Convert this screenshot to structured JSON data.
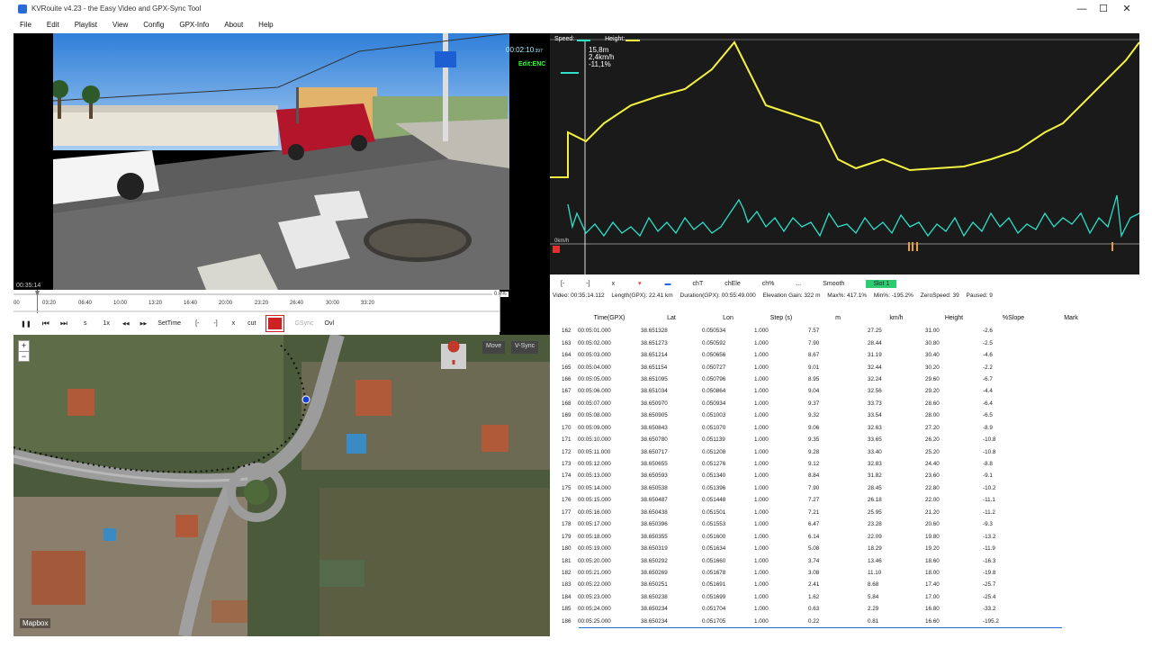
{
  "window": {
    "title": "KVRouite v4.23 - the Easy Video and GPX-Sync Tool",
    "minimize": "—",
    "maximize": "☐",
    "close": "✕"
  },
  "menu": [
    "File",
    "Edit",
    "Playlist",
    "View",
    "Config",
    "GPX-Info",
    "About",
    "Help"
  ],
  "video": {
    "timecode": "00:02:10",
    "timecode_suffix": ".397",
    "edit_state": "Edit:ENC",
    "position_time": "00:35:14",
    "percent": "0.0%"
  },
  "timeline": {
    "ticks": [
      "00",
      "03:20",
      "06:40",
      "10:00",
      "13:20",
      "16:40",
      "20:00",
      "23:20",
      "26:40",
      "30:00",
      "33:20"
    ]
  },
  "controls": {
    "pause": "❚❚",
    "prev": "⏮",
    "next": "⏭",
    "s": "s",
    "speed": "1x",
    "rew": "◀◀",
    "fwd": "▶▶",
    "settime": "SetTime",
    "mark_in": "[-",
    "mark_out": "-]",
    "x": "x",
    "cut": "cut",
    "gsync": "GSync",
    "ovl": "Ovl"
  },
  "map": {
    "zoom_in": "+",
    "zoom_out": "−",
    "move": "Move",
    "vsync": "V-Sync",
    "attribution": "Mapbox"
  },
  "chart": {
    "legend_speed": "Speed:",
    "legend_height": "Height:",
    "readout": [
      "15,8m",
      "2,4km/h",
      "-11,1%"
    ],
    "unit_label": "0km/h",
    "speed_color": "#2de0c8",
    "height_color": "#f4f240"
  },
  "chart_ctl": [
    "[-",
    "-]",
    "x",
    "🔻",
    "▬",
    "chT",
    "chEle",
    "ch%",
    "...",
    "Smooth"
  ],
  "slot": "Slot 1",
  "info": [
    "Video: 00:35:14.112",
    "Length(GPX): 22.41 km",
    "Duration(GPX): 00:55:49.000",
    "Elevation Gain: 322 m",
    "Max%: 417.1%",
    "Min%: -195.2%",
    "ZeroSpeed: 39",
    "Paused: 9"
  ],
  "table": {
    "headers": [
      "",
      "Time(GPX)",
      "Lat",
      "Lon",
      "Step (s)",
      "m",
      "km/h",
      "Height",
      "%Slope",
      "Mark"
    ],
    "rows": [
      [
        "162",
        "00:05:01.000",
        "38.651328",
        "0.050534",
        "1.000",
        "7.57",
        "27.25",
        "31.00",
        "-2.6"
      ],
      [
        "163",
        "00:05:02.000",
        "38.651273",
        "0.050592",
        "1.000",
        "7.90",
        "28.44",
        "30.80",
        "-2.5"
      ],
      [
        "164",
        "00:05:03.000",
        "38.651214",
        "0.050656",
        "1.000",
        "8.67",
        "31.19",
        "30.40",
        "-4.6"
      ],
      [
        "165",
        "00:05:04.000",
        "38.651154",
        "0.050727",
        "1.000",
        "9.01",
        "32.44",
        "30.20",
        "-2.2"
      ],
      [
        "166",
        "00:05:05.000",
        "38.651095",
        "0.050796",
        "1.000",
        "8.95",
        "32.24",
        "29.60",
        "-6.7"
      ],
      [
        "167",
        "00:05:06.000",
        "38.651034",
        "0.050864",
        "1.000",
        "9.04",
        "32.56",
        "29.20",
        "-4.4"
      ],
      [
        "168",
        "00:05:07.000",
        "38.650970",
        "0.050934",
        "1.000",
        "9.37",
        "33.73",
        "28.60",
        "-6.4"
      ],
      [
        "169",
        "00:05:08.000",
        "38.650905",
        "0.051003",
        "1.000",
        "9.32",
        "33.54",
        "28.00",
        "-6.5"
      ],
      [
        "170",
        "00:05:09.000",
        "38.650843",
        "0.051070",
        "1.000",
        "9.06",
        "32.63",
        "27.20",
        "-8.9"
      ],
      [
        "171",
        "00:05:10.000",
        "38.650780",
        "0.051139",
        "1.000",
        "9.35",
        "33.65",
        "26.20",
        "-10.8"
      ],
      [
        "172",
        "00:05:11.000",
        "38.650717",
        "0.051208",
        "1.000",
        "9.28",
        "33.40",
        "25.20",
        "-10.8"
      ],
      [
        "173",
        "00:05:12.000",
        "38.650655",
        "0.051276",
        "1.000",
        "9.12",
        "32.83",
        "24.40",
        "-8.8"
      ],
      [
        "174",
        "00:05:13.000",
        "38.650593",
        "0.051340",
        "1.000",
        "8.84",
        "31.82",
        "23.60",
        "-9.1"
      ],
      [
        "175",
        "00:05:14.000",
        "38.650538",
        "0.051396",
        "1.000",
        "7.90",
        "28.45",
        "22.80",
        "-10.2"
      ],
      [
        "176",
        "00:05:15.000",
        "38.650487",
        "0.051448",
        "1.000",
        "7.27",
        "26.18",
        "22.00",
        "-11.1"
      ],
      [
        "177",
        "00:05:16.000",
        "38.650438",
        "0.051501",
        "1.000",
        "7.21",
        "25.95",
        "21.20",
        "-11.2"
      ],
      [
        "178",
        "00:05:17.000",
        "38.650396",
        "0.051553",
        "1.000",
        "6.47",
        "23.28",
        "20.60",
        "-9.3"
      ],
      [
        "179",
        "00:05:18.000",
        "38.650355",
        "0.051600",
        "1.000",
        "6.14",
        "22.09",
        "19.80",
        "-13.2"
      ],
      [
        "180",
        "00:05:19.000",
        "38.650319",
        "0.051634",
        "1.000",
        "5.08",
        "18.29",
        "19.20",
        "-11.9"
      ],
      [
        "181",
        "00:05:20.000",
        "38.650292",
        "0.051660",
        "1.000",
        "3.74",
        "13.46",
        "18.60",
        "-16.3"
      ],
      [
        "182",
        "00:05:21.000",
        "38.650269",
        "0.051678",
        "1.000",
        "3.08",
        "11.10",
        "18.00",
        "-19.8"
      ],
      [
        "183",
        "00:05:22.000",
        "38.650251",
        "0.051691",
        "1.000",
        "2.41",
        "8.68",
        "17.40",
        "-25.7"
      ],
      [
        "184",
        "00:05:23.000",
        "38.650238",
        "0.051699",
        "1.000",
        "1.62",
        "5.84",
        "17.00",
        "-25.4"
      ],
      [
        "185",
        "00:05:24.000",
        "38.650234",
        "0.051704",
        "1.000",
        "0.63",
        "2.29",
        "16.80",
        "-33.2"
      ],
      [
        "186",
        "00:05:25.000",
        "38.650234",
        "0.051705",
        "1.000",
        "0.22",
        "0.81",
        "16.60",
        "-195.2"
      ]
    ]
  }
}
